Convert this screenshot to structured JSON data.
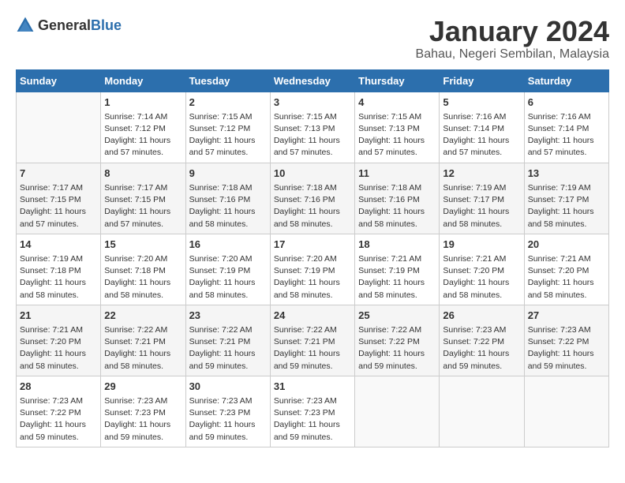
{
  "logo": {
    "text_general": "General",
    "text_blue": "Blue"
  },
  "title": "January 2024",
  "subtitle": "Bahau, Negeri Sembilan, Malaysia",
  "weekdays": [
    "Sunday",
    "Monday",
    "Tuesday",
    "Wednesday",
    "Thursday",
    "Friday",
    "Saturday"
  ],
  "weeks": [
    [
      {
        "day": "",
        "sunrise": "",
        "sunset": "",
        "daylight": ""
      },
      {
        "day": "1",
        "sunrise": "Sunrise: 7:14 AM",
        "sunset": "Sunset: 7:12 PM",
        "daylight": "Daylight: 11 hours and 57 minutes."
      },
      {
        "day": "2",
        "sunrise": "Sunrise: 7:15 AM",
        "sunset": "Sunset: 7:12 PM",
        "daylight": "Daylight: 11 hours and 57 minutes."
      },
      {
        "day": "3",
        "sunrise": "Sunrise: 7:15 AM",
        "sunset": "Sunset: 7:13 PM",
        "daylight": "Daylight: 11 hours and 57 minutes."
      },
      {
        "day": "4",
        "sunrise": "Sunrise: 7:15 AM",
        "sunset": "Sunset: 7:13 PM",
        "daylight": "Daylight: 11 hours and 57 minutes."
      },
      {
        "day": "5",
        "sunrise": "Sunrise: 7:16 AM",
        "sunset": "Sunset: 7:14 PM",
        "daylight": "Daylight: 11 hours and 57 minutes."
      },
      {
        "day": "6",
        "sunrise": "Sunrise: 7:16 AM",
        "sunset": "Sunset: 7:14 PM",
        "daylight": "Daylight: 11 hours and 57 minutes."
      }
    ],
    [
      {
        "day": "7",
        "sunrise": "Sunrise: 7:17 AM",
        "sunset": "Sunset: 7:15 PM",
        "daylight": "Daylight: 11 hours and 57 minutes."
      },
      {
        "day": "8",
        "sunrise": "Sunrise: 7:17 AM",
        "sunset": "Sunset: 7:15 PM",
        "daylight": "Daylight: 11 hours and 57 minutes."
      },
      {
        "day": "9",
        "sunrise": "Sunrise: 7:18 AM",
        "sunset": "Sunset: 7:16 PM",
        "daylight": "Daylight: 11 hours and 58 minutes."
      },
      {
        "day": "10",
        "sunrise": "Sunrise: 7:18 AM",
        "sunset": "Sunset: 7:16 PM",
        "daylight": "Daylight: 11 hours and 58 minutes."
      },
      {
        "day": "11",
        "sunrise": "Sunrise: 7:18 AM",
        "sunset": "Sunset: 7:16 PM",
        "daylight": "Daylight: 11 hours and 58 minutes."
      },
      {
        "day": "12",
        "sunrise": "Sunrise: 7:19 AM",
        "sunset": "Sunset: 7:17 PM",
        "daylight": "Daylight: 11 hours and 58 minutes."
      },
      {
        "day": "13",
        "sunrise": "Sunrise: 7:19 AM",
        "sunset": "Sunset: 7:17 PM",
        "daylight": "Daylight: 11 hours and 58 minutes."
      }
    ],
    [
      {
        "day": "14",
        "sunrise": "Sunrise: 7:19 AM",
        "sunset": "Sunset: 7:18 PM",
        "daylight": "Daylight: 11 hours and 58 minutes."
      },
      {
        "day": "15",
        "sunrise": "Sunrise: 7:20 AM",
        "sunset": "Sunset: 7:18 PM",
        "daylight": "Daylight: 11 hours and 58 minutes."
      },
      {
        "day": "16",
        "sunrise": "Sunrise: 7:20 AM",
        "sunset": "Sunset: 7:19 PM",
        "daylight": "Daylight: 11 hours and 58 minutes."
      },
      {
        "day": "17",
        "sunrise": "Sunrise: 7:20 AM",
        "sunset": "Sunset: 7:19 PM",
        "daylight": "Daylight: 11 hours and 58 minutes."
      },
      {
        "day": "18",
        "sunrise": "Sunrise: 7:21 AM",
        "sunset": "Sunset: 7:19 PM",
        "daylight": "Daylight: 11 hours and 58 minutes."
      },
      {
        "day": "19",
        "sunrise": "Sunrise: 7:21 AM",
        "sunset": "Sunset: 7:20 PM",
        "daylight": "Daylight: 11 hours and 58 minutes."
      },
      {
        "day": "20",
        "sunrise": "Sunrise: 7:21 AM",
        "sunset": "Sunset: 7:20 PM",
        "daylight": "Daylight: 11 hours and 58 minutes."
      }
    ],
    [
      {
        "day": "21",
        "sunrise": "Sunrise: 7:21 AM",
        "sunset": "Sunset: 7:20 PM",
        "daylight": "Daylight: 11 hours and 58 minutes."
      },
      {
        "day": "22",
        "sunrise": "Sunrise: 7:22 AM",
        "sunset": "Sunset: 7:21 PM",
        "daylight": "Daylight: 11 hours and 58 minutes."
      },
      {
        "day": "23",
        "sunrise": "Sunrise: 7:22 AM",
        "sunset": "Sunset: 7:21 PM",
        "daylight": "Daylight: 11 hours and 59 minutes."
      },
      {
        "day": "24",
        "sunrise": "Sunrise: 7:22 AM",
        "sunset": "Sunset: 7:21 PM",
        "daylight": "Daylight: 11 hours and 59 minutes."
      },
      {
        "day": "25",
        "sunrise": "Sunrise: 7:22 AM",
        "sunset": "Sunset: 7:22 PM",
        "daylight": "Daylight: 11 hours and 59 minutes."
      },
      {
        "day": "26",
        "sunrise": "Sunrise: 7:23 AM",
        "sunset": "Sunset: 7:22 PM",
        "daylight": "Daylight: 11 hours and 59 minutes."
      },
      {
        "day": "27",
        "sunrise": "Sunrise: 7:23 AM",
        "sunset": "Sunset: 7:22 PM",
        "daylight": "Daylight: 11 hours and 59 minutes."
      }
    ],
    [
      {
        "day": "28",
        "sunrise": "Sunrise: 7:23 AM",
        "sunset": "Sunset: 7:22 PM",
        "daylight": "Daylight: 11 hours and 59 minutes."
      },
      {
        "day": "29",
        "sunrise": "Sunrise: 7:23 AM",
        "sunset": "Sunset: 7:23 PM",
        "daylight": "Daylight: 11 hours and 59 minutes."
      },
      {
        "day": "30",
        "sunrise": "Sunrise: 7:23 AM",
        "sunset": "Sunset: 7:23 PM",
        "daylight": "Daylight: 11 hours and 59 minutes."
      },
      {
        "day": "31",
        "sunrise": "Sunrise: 7:23 AM",
        "sunset": "Sunset: 7:23 PM",
        "daylight": "Daylight: 11 hours and 59 minutes."
      },
      {
        "day": "",
        "sunrise": "",
        "sunset": "",
        "daylight": ""
      },
      {
        "day": "",
        "sunrise": "",
        "sunset": "",
        "daylight": ""
      },
      {
        "day": "",
        "sunrise": "",
        "sunset": "",
        "daylight": ""
      }
    ]
  ]
}
